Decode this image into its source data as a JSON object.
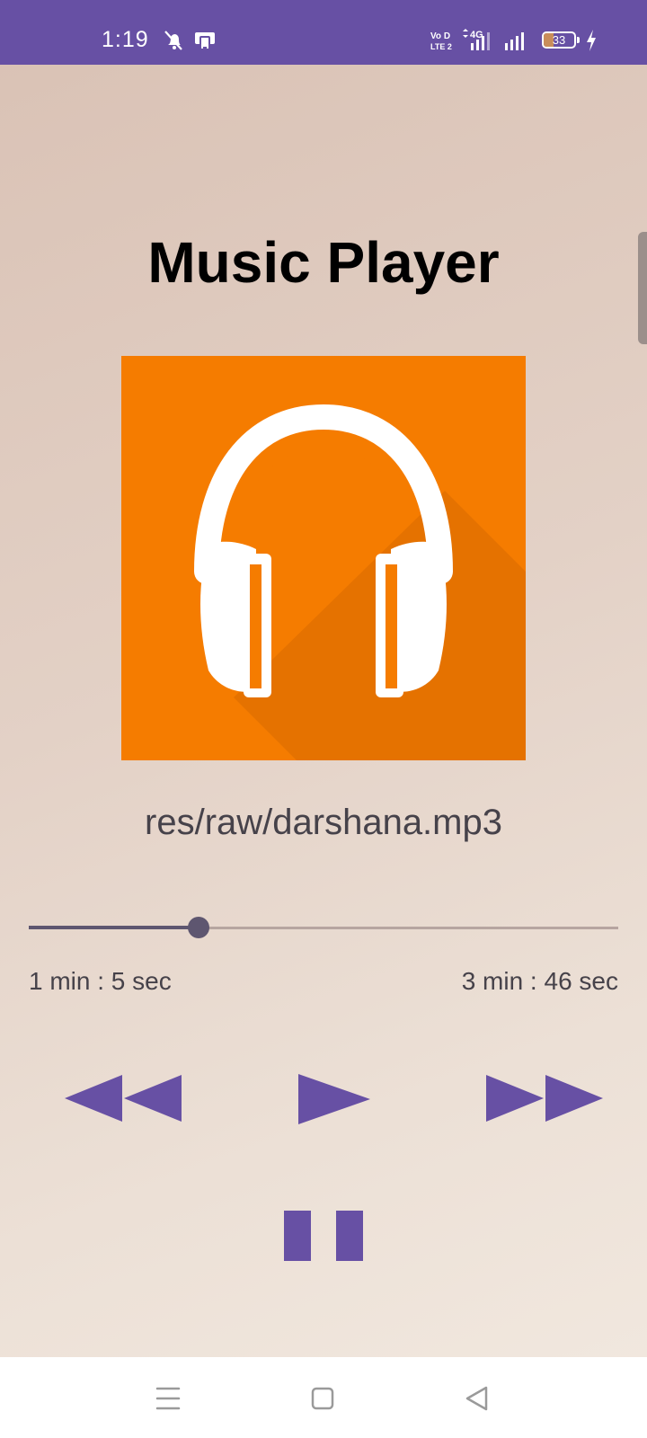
{
  "status_bar": {
    "time": "1:19",
    "network_type": "4G",
    "volte_label": "Vo LTE",
    "battery_level": "33",
    "battery_percent": 33,
    "charging": true,
    "icons": [
      "notification-muted-icon",
      "screen-mirror-icon",
      "volte-icon",
      "mobile-data-icon",
      "signal-strength-icon",
      "signal-strength-icon",
      "battery-icon",
      "charging-bolt-icon"
    ]
  },
  "app": {
    "title": "Music Player",
    "album_art_icon": "headphones-icon",
    "file_path": "res/raw/darshana.mp3"
  },
  "playback": {
    "elapsed": "1 min : 5 sec",
    "total": "3 min : 46 sec",
    "progress_fraction": 0.288
  },
  "controls": {
    "rewind_icon": "rewind-icon",
    "play_icon": "play-icon",
    "fast_forward_icon": "fast-forward-icon",
    "pause_icon": "pause-icon"
  },
  "navigation_bar": {
    "icons": [
      "menu-icon",
      "home-icon",
      "back-icon"
    ]
  },
  "colors": {
    "accent": "#6750a4",
    "album_art_background": "#f57c00",
    "seek_progress": "#5e5670",
    "seek_track": "#b6a5a0",
    "text": "#46424a"
  }
}
